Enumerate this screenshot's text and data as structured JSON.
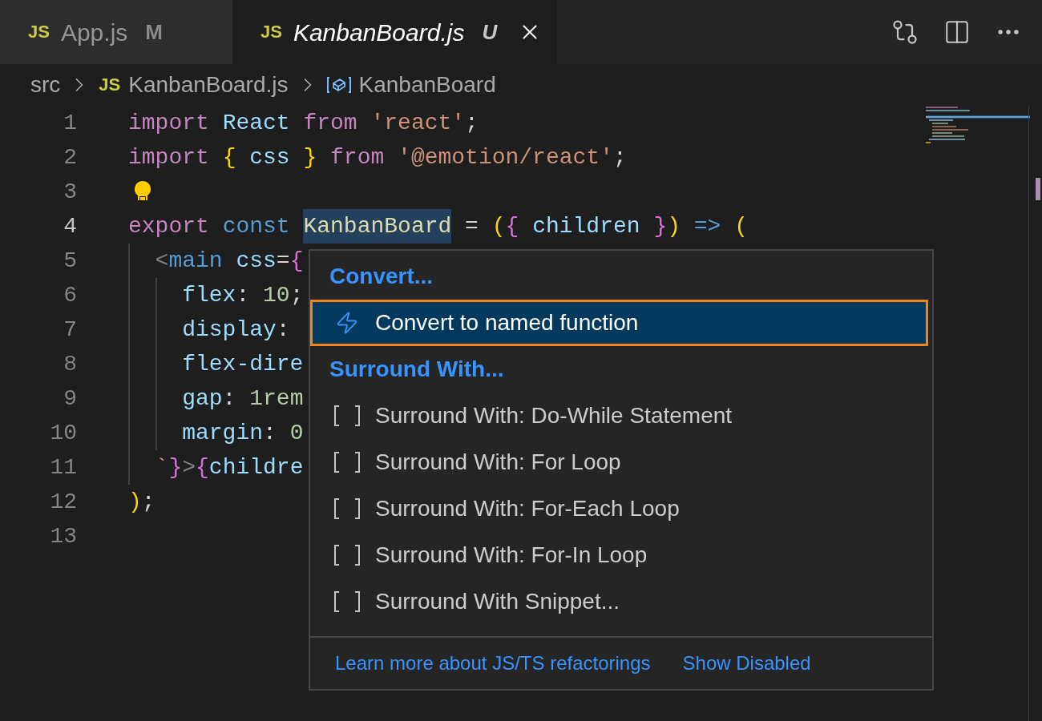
{
  "tabs": [
    {
      "icon": "JS",
      "label": "App.js",
      "status": "M",
      "selected": false,
      "preview": false
    },
    {
      "icon": "JS",
      "label": "KanbanBoard.js",
      "status": "U",
      "selected": true,
      "preview": true
    }
  ],
  "breadcrumb": [
    {
      "kind": "folder",
      "label": "src"
    },
    {
      "kind": "file",
      "icon": "JS",
      "label": "KanbanBoard.js"
    },
    {
      "kind": "symbol",
      "label": "KanbanBoard"
    }
  ],
  "code": [
    {
      "number": "1",
      "current": false,
      "tokens": [
        {
          "kind": "keyword",
          "text": "import"
        },
        {
          "kind": "variable",
          "text": " React"
        },
        {
          "kind": "keyword",
          "text": " from"
        },
        {
          "kind": "string",
          "text": " 'react'"
        },
        {
          "kind": "punct",
          "text": ";"
        }
      ]
    },
    {
      "number": "2",
      "current": false,
      "tokens": [
        {
          "kind": "keyword",
          "text": "import"
        },
        {
          "kind": "bracket1",
          "text": " {"
        },
        {
          "kind": "variable",
          "text": " css"
        },
        {
          "kind": "bracket1",
          "text": " }"
        },
        {
          "kind": "keyword",
          "text": " from"
        },
        {
          "kind": "string",
          "text": " '@emotion/react'"
        },
        {
          "kind": "punct",
          "text": ";"
        }
      ]
    },
    {
      "number": "3",
      "current": false,
      "lightbulb": true
    },
    {
      "number": "4",
      "current": true,
      "tokens": [
        {
          "kind": "keyword",
          "text": "export"
        },
        {
          "kind": "storage",
          "text": " const "
        },
        {
          "kind": "function",
          "text": "KanbanBoard",
          "highlighted": true
        },
        {
          "kind": "punct",
          "text": " = "
        },
        {
          "kind": "bracket1",
          "text": "("
        },
        {
          "kind": "bracket2",
          "text": "{"
        },
        {
          "kind": "variable",
          "text": " children"
        },
        {
          "kind": "bracket2",
          "text": " }"
        },
        {
          "kind": "bracket1",
          "text": ")"
        },
        {
          "kind": "storage",
          "text": " =>"
        },
        {
          "kind": "bracket1",
          "text": " ("
        }
      ]
    },
    {
      "number": "5",
      "current": false,
      "tokens": [
        {
          "kind": "tag-punct",
          "text": "  <"
        },
        {
          "kind": "tag",
          "text": "main"
        },
        {
          "kind": "variable",
          "text": " css"
        },
        {
          "kind": "punct",
          "text": "="
        },
        {
          "kind": "bracket2",
          "text": "{"
        }
      ]
    },
    {
      "number": "6",
      "current": false,
      "tokens": [
        {
          "kind": "variable",
          "text": "    flex"
        },
        {
          "kind": "punct",
          "text": ": "
        },
        {
          "kind": "number",
          "text": "10"
        },
        {
          "kind": "punct",
          "text": ";"
        }
      ]
    },
    {
      "number": "7",
      "current": false,
      "tokens": [
        {
          "kind": "variable",
          "text": "    display"
        },
        {
          "kind": "punct",
          "text": ":"
        }
      ]
    },
    {
      "number": "8",
      "current": false,
      "tokens": [
        {
          "kind": "variable",
          "text": "    flex-dire"
        }
      ]
    },
    {
      "number": "9",
      "current": false,
      "tokens": [
        {
          "kind": "variable",
          "text": "    gap"
        },
        {
          "kind": "punct",
          "text": ": "
        },
        {
          "kind": "number",
          "text": "1rem"
        }
      ]
    },
    {
      "number": "10",
      "current": false,
      "tokens": [
        {
          "kind": "variable",
          "text": "    margin"
        },
        {
          "kind": "punct",
          "text": ": "
        },
        {
          "kind": "number",
          "text": "0"
        }
      ]
    },
    {
      "number": "11",
      "current": false,
      "tokens": [
        {
          "kind": "string",
          "text": "  `"
        },
        {
          "kind": "bracket2",
          "text": "}"
        },
        {
          "kind": "tag-punct",
          "text": ">"
        },
        {
          "kind": "bracket2",
          "text": "{"
        },
        {
          "kind": "variable",
          "text": "childre"
        }
      ]
    },
    {
      "number": "12",
      "current": false,
      "tokens": [
        {
          "kind": "bracket1",
          "text": ")"
        },
        {
          "kind": "punct",
          "text": ";"
        }
      ]
    },
    {
      "number": "13",
      "current": false
    }
  ],
  "menu": {
    "groups": [
      {
        "header": "Convert...",
        "items": [
          {
            "kind": "refactor",
            "label": "Convert to named function",
            "selected": true
          }
        ]
      },
      {
        "header": "Surround With...",
        "items": [
          {
            "kind": "snippet",
            "label": "Surround With: Do-While Statement",
            "selected": false
          },
          {
            "kind": "snippet",
            "label": "Surround With: For Loop",
            "selected": false
          },
          {
            "kind": "snippet",
            "label": "Surround With: For-Each Loop",
            "selected": false
          },
          {
            "kind": "snippet",
            "label": "Surround With: For-In Loop",
            "selected": false
          },
          {
            "kind": "snippet",
            "label": "Surround With Snippet...",
            "selected": false
          }
        ]
      }
    ],
    "footer": [
      "Learn more about JS/TS refactorings",
      "Show Disabled"
    ]
  }
}
